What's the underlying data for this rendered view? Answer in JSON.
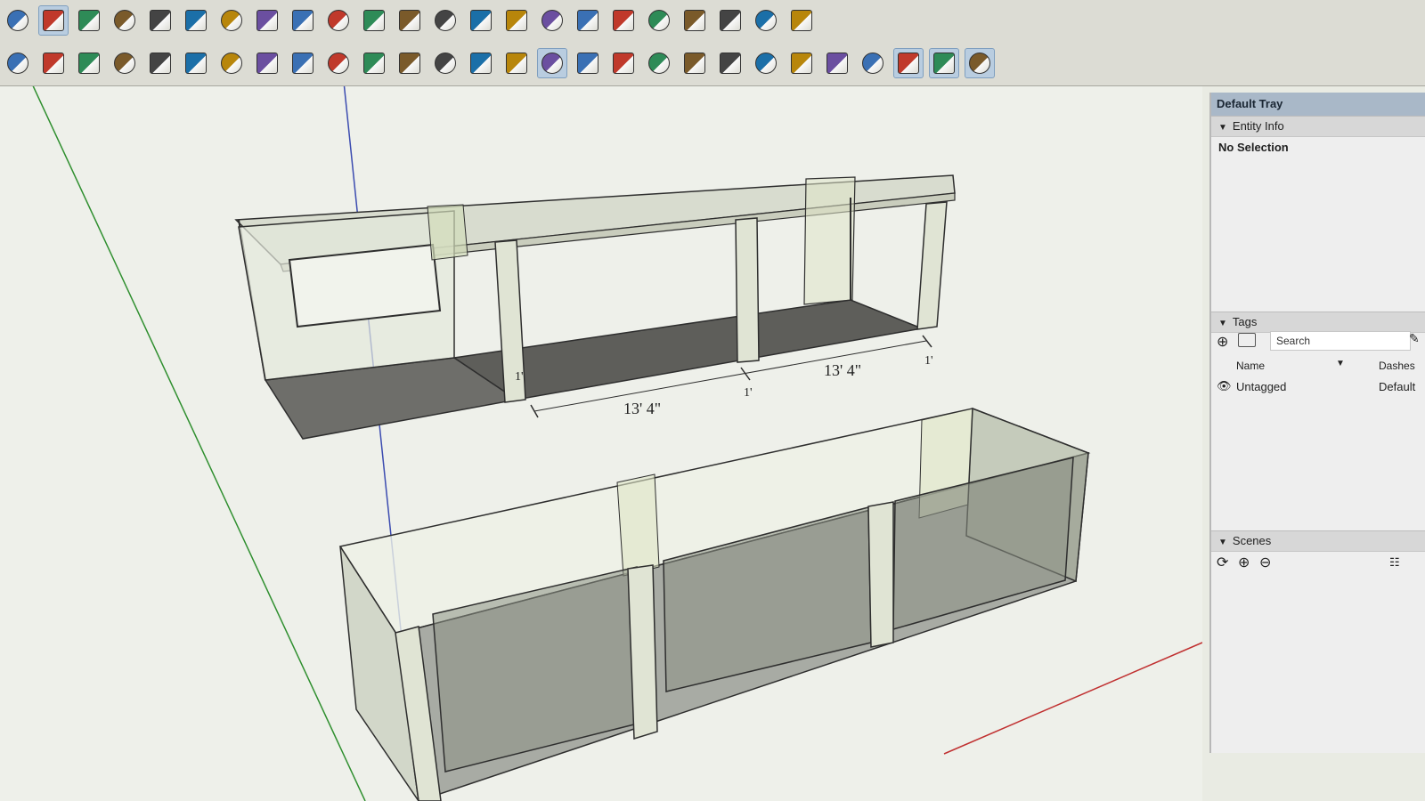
{
  "toolbar": {
    "row1": [
      "select-tool",
      "paint-bucket-tool",
      "layers-tool",
      "push-box-tool",
      "house-icon",
      "door-icon",
      "home-icon",
      "building-icon",
      "house-outline-icon",
      "garage-icon",
      "solid-union-icon",
      "solid-intersect-icon",
      "solid-subtract-icon",
      "solid-trim-icon",
      "solid-split-icon",
      "outer-shell-icon",
      "sandbox-contours-icon",
      "sandbox-grid-icon",
      "smoove-icon",
      "stamp-icon",
      "drape-icon",
      "add-detail-icon",
      "flip-edge-icon"
    ],
    "row2": [
      "line-tool",
      "arc-tool",
      "freehand-tool",
      "move-tool",
      "push-pull-tool",
      "rotate-tool",
      "follow-me-tool",
      "scale-tool",
      "offset-tool",
      "tape-measure-tool",
      "dimension-tool",
      "protractor-tool",
      "text-tool",
      "axes-tool",
      "3d-text-tool",
      "orbit-tool",
      "pan-tool",
      "zoom-tool",
      "zoom-window-tool",
      "zoom-extents-tool",
      "previous-view-tool",
      "position-camera-tool",
      "look-around-tool",
      "walk-tool",
      "section-plane-tool",
      "display-section-planes-tool",
      "display-section-cuts-tool",
      "display-section-fill-tool"
    ]
  },
  "colors": {
    "accent": "#7f9fbf",
    "glass": "#c8d6b0",
    "edge": "#333333",
    "floor": "#6a6a66",
    "green_axis": "#2f8f2f",
    "blue_axis": "#3b4bb0",
    "red_axis": "#c03030"
  },
  "tray": {
    "title": "Default Tray",
    "entity_info": {
      "header": "Entity Info",
      "status": "No Selection"
    },
    "tags": {
      "header": "Tags",
      "search_placeholder": "Search",
      "col_name": "Name",
      "col_dashes": "Dashes",
      "rows": [
        {
          "name": "Untagged",
          "dashes": "Default"
        }
      ]
    },
    "scenes": {
      "header": "Scenes"
    }
  },
  "model": {
    "dimensions": [
      "13' 4\"",
      "13' 4\"",
      "1'",
      "1'",
      "1'"
    ]
  }
}
